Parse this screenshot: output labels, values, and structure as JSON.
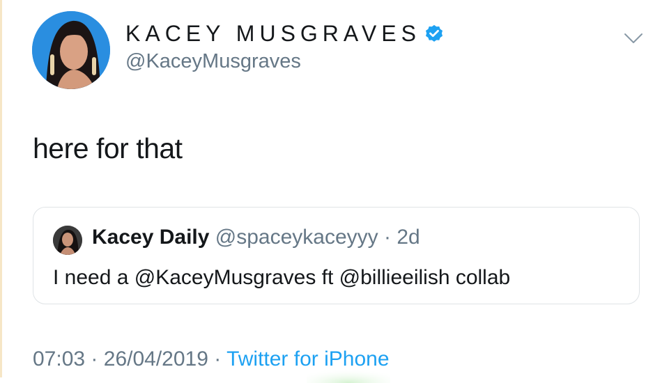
{
  "tweet": {
    "author": {
      "display_name": "KACEY MUSGRAVES",
      "handle": "@KaceyMusgraves",
      "verified": true
    },
    "text": "here for that",
    "quoted": {
      "display_name": "Kacey Daily",
      "handle": "@spaceykaceyyy",
      "separator": "·",
      "time": "2d",
      "text": "I need a @KaceyMusgraves ft @billieeilish collab"
    },
    "meta": {
      "time": "07:03",
      "separator": "·",
      "date": "26/04/2019",
      "source": "Twitter for iPhone"
    }
  },
  "icons": {
    "verified": "verified-badge-icon",
    "menu": "chevron-down-icon"
  },
  "colors": {
    "primary_text": "#14171a",
    "secondary_text": "#657786",
    "link": "#1da1f2",
    "border": "#dfe3e6"
  }
}
